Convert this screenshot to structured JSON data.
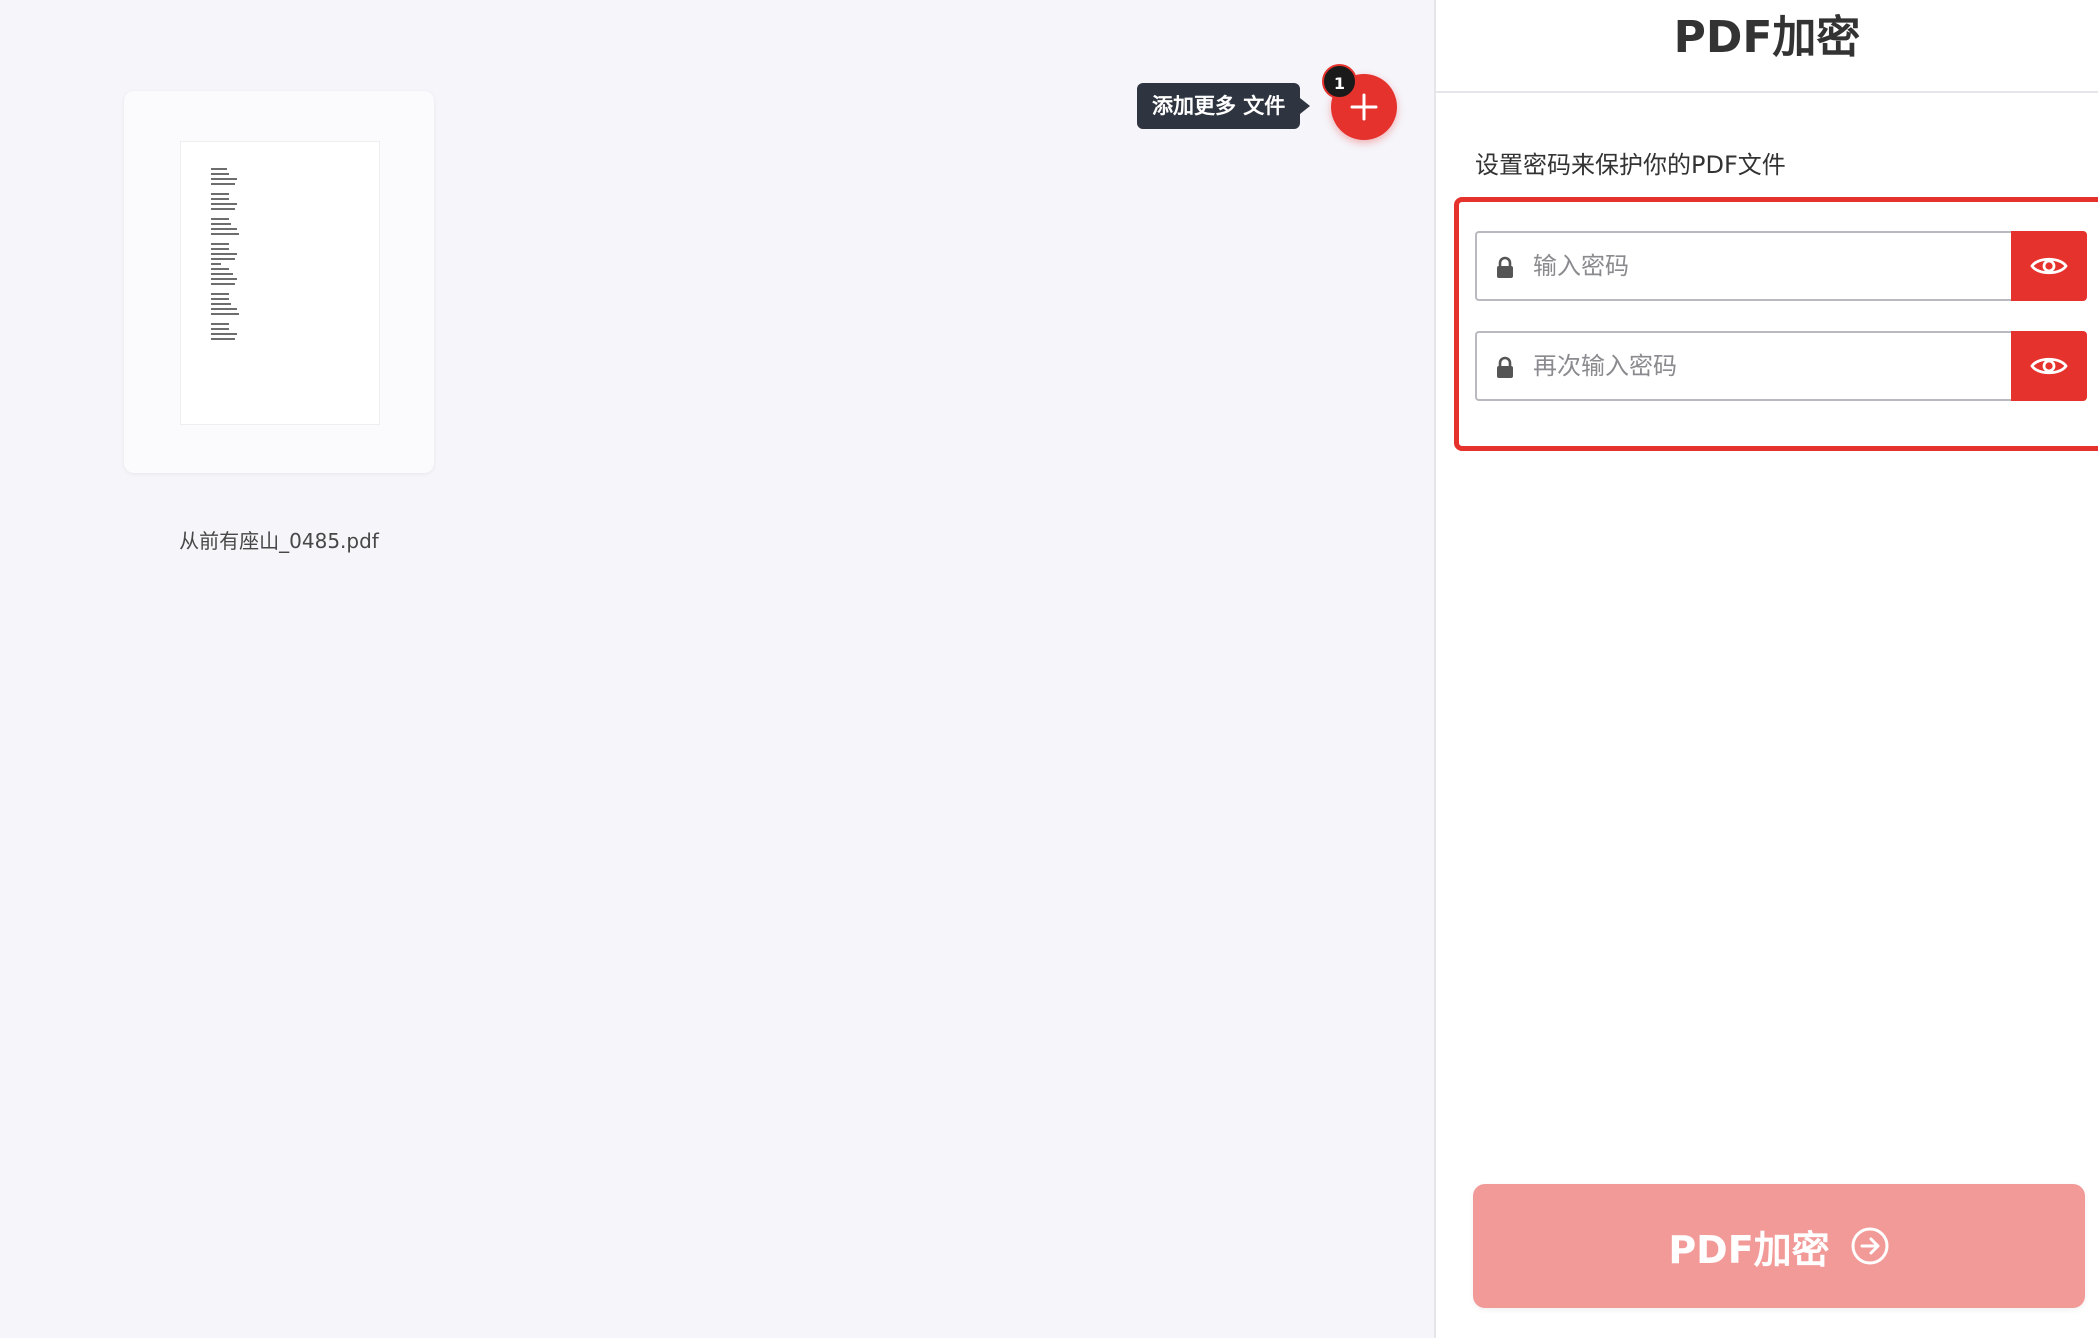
{
  "workspace": {
    "file": {
      "name": "从前有座山_0485.pdf"
    },
    "add_files": {
      "tooltip": "添加更多 文件",
      "count_badge": "1"
    }
  },
  "sidebar": {
    "title": "PDF加密",
    "description": "设置密码来保护你的PDF文件",
    "password_field": {
      "placeholder": "输入密码",
      "value": ""
    },
    "confirm_field": {
      "placeholder": "再次输入密码",
      "value": ""
    },
    "submit_label": "PDF加密"
  },
  "colors": {
    "accent": "#e5322d",
    "submit_disabled": "#f29a98",
    "workspace_bg": "#f5f5fa",
    "tooltip_bg": "#2f3540"
  },
  "icons": [
    "plus-icon",
    "lock-icon",
    "eye-icon",
    "arrow-circle-right-icon"
  ]
}
